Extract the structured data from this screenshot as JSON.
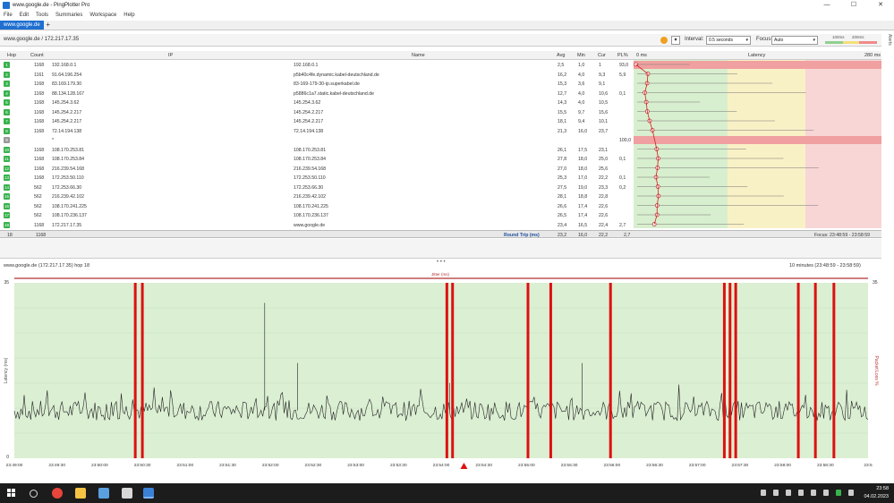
{
  "window": {
    "title": "www.google.de - PingPlotter Pro",
    "minimize_glyph": "—",
    "maximize_glyph": "☐",
    "close_glyph": "✕"
  },
  "menu": [
    "File",
    "Edit",
    "Tools",
    "Summaries",
    "Workspace",
    "Help"
  ],
  "tabs": {
    "active": "www.google.de",
    "add_glyph": "+"
  },
  "toolbar": {
    "target": "www.google.de / 172.217.17.35",
    "interval_label": "Interval:",
    "interval_value": "0.5 seconds",
    "focus_label": "Focus:",
    "focus_value": "Auto",
    "legend_100": "100ms",
    "legend_200": "200ms",
    "alerts_label": "Alerts"
  },
  "columns": {
    "hop": "Hop",
    "count": "Count",
    "ip": "IP",
    "name": "Name",
    "avg": "Avg",
    "min": "Min",
    "cur": "Cur",
    "pl": "PL%",
    "zero": "0 ms",
    "latency": "Latency",
    "max": "280 ms"
  },
  "hops": [
    {
      "hop": "1",
      "count": "1168",
      "ip": "192.168.0.1",
      "name": "192.168.0.1",
      "avg": "2,5",
      "min": "1,0",
      "cur": "1",
      "pl": "93,0"
    },
    {
      "hop": "2",
      "count": "1161",
      "ip": "91.64.196.254",
      "name": "p5b40c4fe.dynamic.kabel-deutschland.de",
      "avg": "16,2",
      "min": "4,0",
      "cur": "9,3",
      "pl": "5,9"
    },
    {
      "hop": "3",
      "count": "1168",
      "ip": "83.169.179.30",
      "name": "83-169-179-30-ip.superkabel.de",
      "avg": "15,3",
      "min": "3,6",
      "cur": "9,1",
      "pl": ""
    },
    {
      "hop": "4",
      "count": "1168",
      "ip": "88.134.128.167",
      "name": "p5886c1a7.static.kabel-deutschland.de",
      "avg": "12,7",
      "min": "4,0",
      "cur": "10,6",
      "pl": "0,1"
    },
    {
      "hop": "5",
      "count": "1168",
      "ip": "145.254.3.62",
      "name": "145.254.3.62",
      "avg": "14,3",
      "min": "4,0",
      "cur": "10,5",
      "pl": ""
    },
    {
      "hop": "6",
      "count": "1168",
      "ip": "145.254.2.217",
      "name": "145.254.2.217",
      "avg": "15,5",
      "min": "9,7",
      "cur": "15,6",
      "pl": ""
    },
    {
      "hop": "7",
      "count": "1168",
      "ip": "145.254.2.217",
      "name": "145.254.2.217",
      "avg": "18,1",
      "min": "9,4",
      "cur": "10,1",
      "pl": ""
    },
    {
      "hop": "8",
      "count": "1168",
      "ip": "72.14.194.138",
      "name": "72.14.194.138",
      "avg": "21,3",
      "min": "16,0",
      "cur": "23,7",
      "pl": ""
    },
    {
      "hop": "9",
      "count": "",
      "ip": "*",
      "name": "",
      "avg": "",
      "min": "",
      "cur": "",
      "pl": "100,0"
    },
    {
      "hop": "10",
      "count": "1168",
      "ip": "108.170.253.81",
      "name": "108.170.253.81",
      "avg": "26,1",
      "min": "17,5",
      "cur": "23,1",
      "pl": ""
    },
    {
      "hop": "11",
      "count": "1168",
      "ip": "108.170.253.84",
      "name": "108.170.253.84",
      "avg": "27,8",
      "min": "18,0",
      "cur": "25,0",
      "pl": "0,1"
    },
    {
      "hop": "12",
      "count": "1168",
      "ip": "216.239.54.168",
      "name": "216.239.54.168",
      "avg": "27,0",
      "min": "18,0",
      "cur": "25,6",
      "pl": ""
    },
    {
      "hop": "13",
      "count": "1168",
      "ip": "172.253.50.110",
      "name": "172.253.50.110",
      "avg": "25,3",
      "min": "17,0",
      "cur": "22,2",
      "pl": "0,1"
    },
    {
      "hop": "14",
      "count": "562",
      "ip": "172.253.66.30",
      "name": "172.253.66.30",
      "avg": "27,5",
      "min": "19,0",
      "cur": "23,3",
      "pl": "0,2"
    },
    {
      "hop": "15",
      "count": "562",
      "ip": "216.239.42.102",
      "name": "216.239.42.102",
      "avg": "28,1",
      "min": "18,8",
      "cur": "22,8",
      "pl": ""
    },
    {
      "hop": "16",
      "count": "562",
      "ip": "108.170.241.225",
      "name": "108.170.241.225",
      "avg": "26,6",
      "min": "17,4",
      "cur": "22,6",
      "pl": ""
    },
    {
      "hop": "17",
      "count": "562",
      "ip": "108.170.236.137",
      "name": "108.170.236.137",
      "avg": "26,5",
      "min": "17,4",
      "cur": "22,6",
      "pl": ""
    },
    {
      "hop": "18",
      "count": "1168",
      "ip": "172.217.17.35",
      "name": "www.google.de",
      "avg": "23,4",
      "min": "16,5",
      "cur": "22,4",
      "pl": "2,7"
    }
  ],
  "summary": {
    "count": "1168",
    "label": "Round Trip (ms)",
    "avg": "23,2",
    "min": "16,0",
    "cur": "22,2",
    "pl": "2,7",
    "focus": "Focus: 23:48:59 - 23:58:59"
  },
  "splitter": "• • •",
  "timeline": {
    "title": "www.google.de (172.217.17.35) hop 18",
    "range": "10 minutes (23:48:59 - 23:58:59)",
    "jitter_label": "Jitter (ms)",
    "ylabel_left": "Latency (ms)",
    "ylabel_right": "Packet Loss %",
    "ytop": "35",
    "yzero": "0",
    "xticks": [
      "23:49:00",
      "23:49:30",
      "23:50:00",
      "23:50:30",
      "23:51:00",
      "23:51:30",
      "23:52:00",
      "23:52:30",
      "23:53:00",
      "23:53:30",
      "23:54:00",
      "23:54:30",
      "23:55:00",
      "23:55:30",
      "23:56:00",
      "23:56:30",
      "23:57:00",
      "23:57:30",
      "23:58:00",
      "23:58:30",
      "23:5"
    ]
  },
  "chart_data": {
    "type": "line",
    "title": "www.google.de (172.217.17.35) hop 18",
    "xlabel": "",
    "ylabel": "Latency (ms)",
    "ylim": [
      0,
      35
    ],
    "packet_loss_times": [
      "23:50:24",
      "23:50:29",
      "23:54:03",
      "23:54:07",
      "23:55:00",
      "23:55:16",
      "23:55:58",
      "23:57:18",
      "23:57:22",
      "23:57:26",
      "23:58:10",
      "23:58:22",
      "23:58:35"
    ],
    "latency_baseline_ms": 9.5,
    "latency_spikes": [
      {
        "t": "23:51:55",
        "ms": 31
      },
      {
        "t": "23:52:18",
        "ms": 19
      },
      {
        "t": "23:55:38",
        "ms": 19
      },
      {
        "t": "23:54:05",
        "ms": 15
      }
    ]
  },
  "taskbar": {
    "time": "23:58",
    "date": "04.02.2023"
  }
}
